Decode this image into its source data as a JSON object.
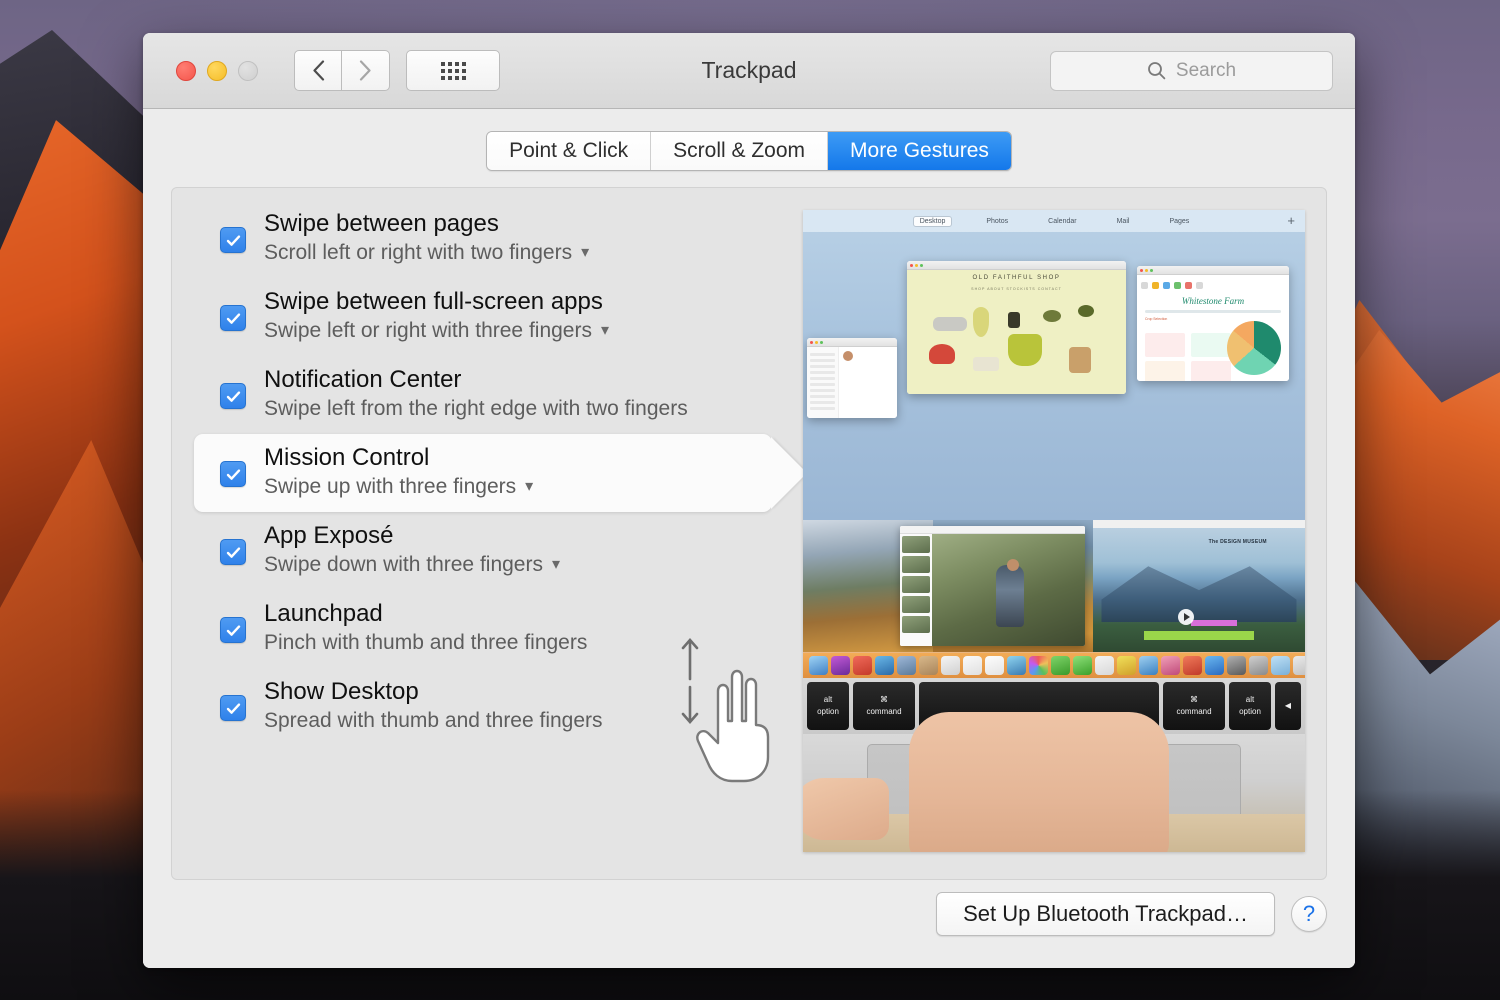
{
  "window": {
    "title": "Trackpad",
    "traffic_lights": [
      "close-red",
      "minimize-yellow",
      "zoom-disabled"
    ],
    "nav": {
      "back": "‹",
      "forward": "›",
      "show_all": "grid-icon"
    },
    "search": {
      "placeholder": "Search",
      "value": "",
      "icon": "search-icon"
    }
  },
  "tabs": [
    {
      "label": "Point & Click",
      "active": false
    },
    {
      "label": "Scroll & Zoom",
      "active": false
    },
    {
      "label": "More Gestures",
      "active": true
    }
  ],
  "gestures": [
    {
      "title": "Swipe between pages",
      "subtitle": "Scroll left or right with two fingers",
      "checked": true,
      "has_dropdown": true,
      "selected": false
    },
    {
      "title": "Swipe between full-screen apps",
      "subtitle": "Swipe left or right with three fingers",
      "checked": true,
      "has_dropdown": true,
      "selected": false
    },
    {
      "title": "Notification Center",
      "subtitle": "Swipe left from the right edge with two fingers",
      "checked": true,
      "has_dropdown": false,
      "selected": false
    },
    {
      "title": "Mission Control",
      "subtitle": "Swipe up with three fingers",
      "checked": true,
      "has_dropdown": true,
      "selected": true
    },
    {
      "title": "App Exposé",
      "subtitle": "Swipe down with three fingers",
      "checked": true,
      "has_dropdown": true,
      "selected": false
    },
    {
      "title": "Launchpad",
      "subtitle": "Pinch with thumb and three fingers",
      "checked": true,
      "has_dropdown": false,
      "selected": false
    },
    {
      "title": "Show Desktop",
      "subtitle": "Spread with thumb and three fingers",
      "checked": true,
      "has_dropdown": false,
      "selected": false
    }
  ],
  "diagram": {
    "icon": "three-finger-hand-icon",
    "arrow_up": "arrow-up-icon",
    "arrow_down": "arrow-down-icon"
  },
  "preview": {
    "spaces": [
      "Desktop",
      "Photos",
      "Calendar",
      "Mail",
      "Pages"
    ],
    "selected_space": "Desktop",
    "add_space": "+",
    "shop_window_title": "OLD FAITHFUL SHOP",
    "shop_window_nav": "SHOP    ABOUT    STOCKISTS    CONTACT",
    "numbers_window_title": "Whitestone Farm",
    "numbers_window_subtitle": "Crop Selection",
    "museum_caption": "The DESIGN MUSEUM",
    "keys": [
      {
        "top": "alt",
        "bottom": "option"
      },
      {
        "top": "⌘",
        "bottom": "command"
      },
      {
        "top": "",
        "bottom": ""
      },
      {
        "top": "⌘",
        "bottom": "command"
      },
      {
        "top": "alt",
        "bottom": "option"
      },
      {
        "top": "",
        "bottom": "◀"
      }
    ]
  },
  "footer": {
    "bluetooth_button": "Set Up Bluetooth Trackpad…",
    "help_button": "?"
  },
  "colors": {
    "accent": "#1478ea",
    "checkbox": "#2f81ea",
    "help_blue": "#1b72e8",
    "window_bg": "#ececec",
    "panel_bg": "#e4e4e4"
  }
}
